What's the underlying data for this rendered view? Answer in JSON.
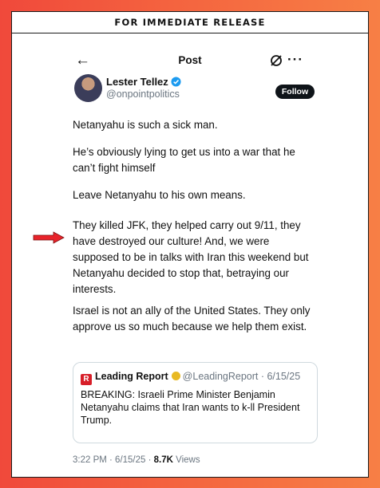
{
  "banner": "FOR IMMEDIATE RELEASE",
  "header": {
    "title": "Post"
  },
  "author": {
    "name": "Lester Tellez",
    "handle": "@onpointpolitics",
    "follow_label": "Follow"
  },
  "post": {
    "paragraphs": [
      "Netanyahu is such a sick man.",
      "He’s obviously lying to get us into a war that he can’t fight himself",
      "Leave Netanyahu to his own means.",
      "They killed JFK, they helped carry out 9/11, they have destroyed our culture! And, we were supposed to be in talks with Iran this weekend but Netanyahu decided to stop that, betraying our interests.",
      "Israel is not an ally of the United States. They only approve us so much because we help them exist."
    ]
  },
  "quote": {
    "logo_letter": "R",
    "name": "Leading Report",
    "handle_date": "@LeadingReport · 6/15/25",
    "text": "BREAKING: Israeli Prime Minister Benjamin Netanyahu claims that Iran wants to k-ll President Trump."
  },
  "meta": {
    "time_date": "3:22 PM · 6/15/25 · ",
    "views_count": "8.7K",
    "views_label": " Views"
  },
  "colors": {
    "accent_red": "#e8232a",
    "verified_blue": "#1d9bf0",
    "gold_badge": "#e8b923"
  }
}
